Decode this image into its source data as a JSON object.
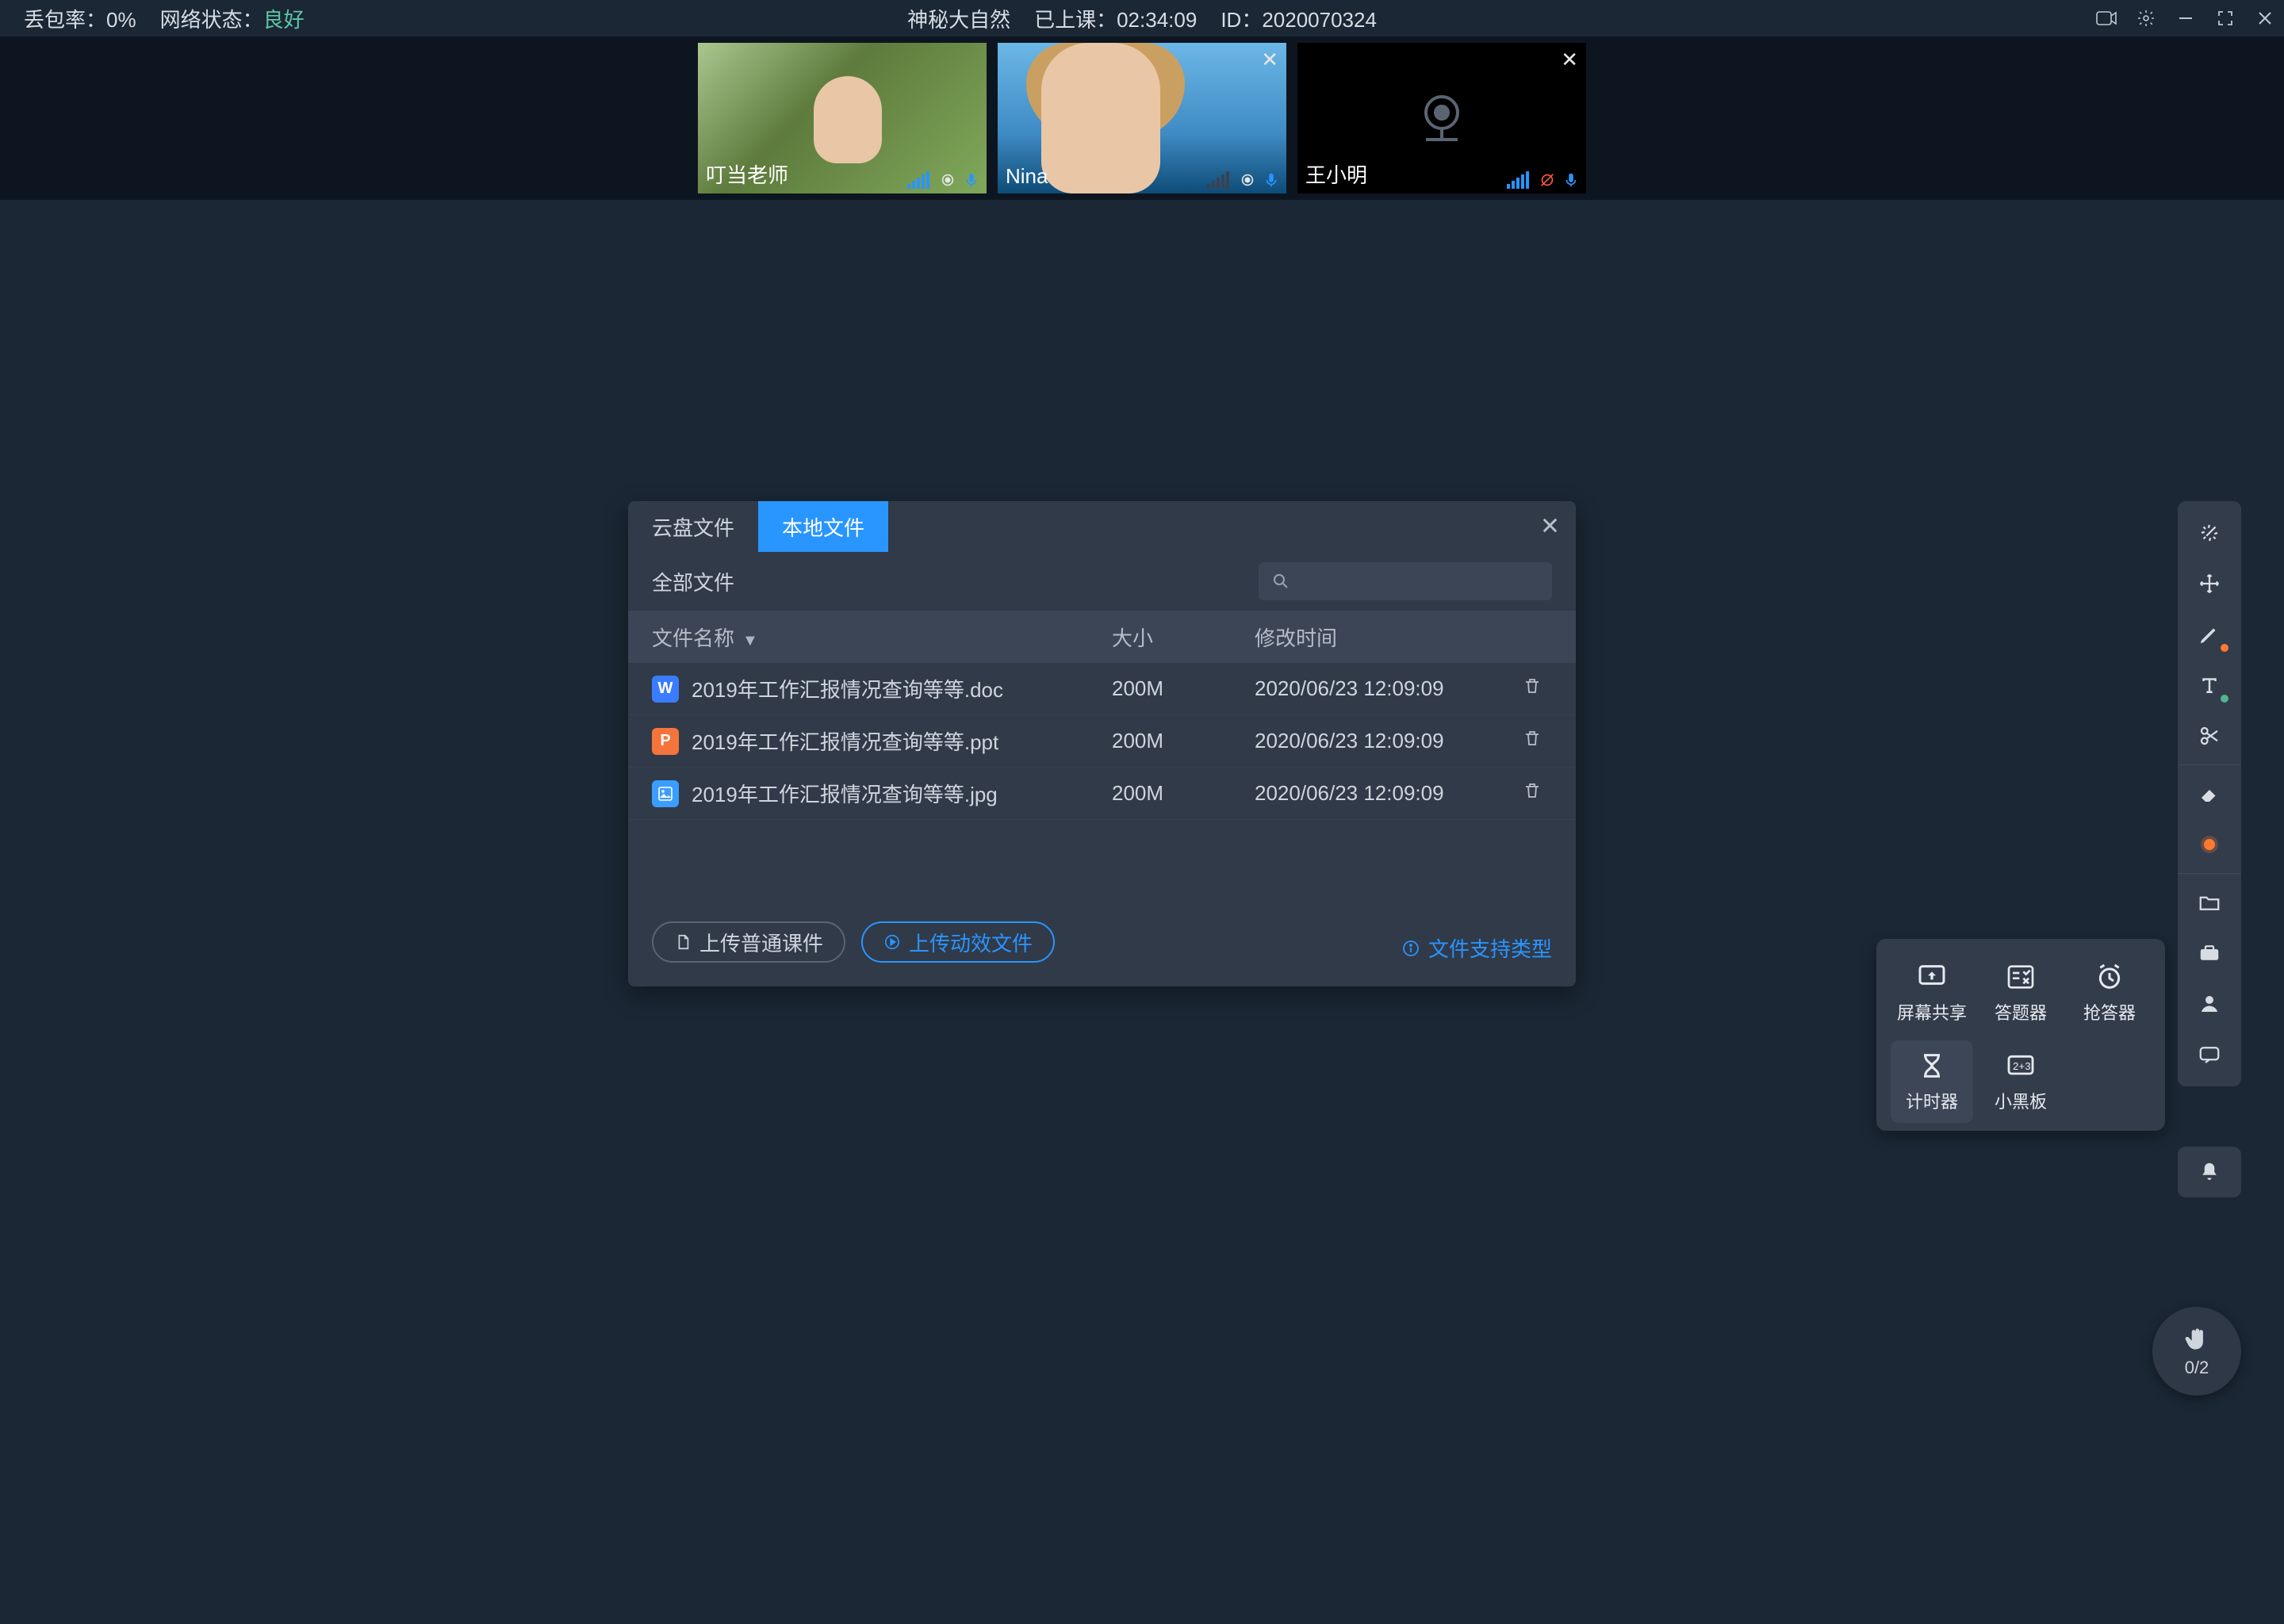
{
  "topbar": {
    "packet_loss_label": "丢包率：",
    "packet_loss_value": "0%",
    "network_label": "网络状态：",
    "network_value": "良好",
    "title": "神秘大自然",
    "elapsed_label": "已上课：",
    "elapsed_value": "02:34:09",
    "id_label": "ID：",
    "id_value": "2020070324"
  },
  "participants": [
    {
      "name": "叮当老师",
      "camera_off": false,
      "muted": false,
      "closable": false
    },
    {
      "name": "Nina",
      "camera_off": false,
      "muted": false,
      "closable": true
    },
    {
      "name": "王小明",
      "camera_off": true,
      "muted": true,
      "closable": true
    }
  ],
  "dialog": {
    "tabs": {
      "cloud": "云盘文件",
      "local": "本地文件",
      "active": "local"
    },
    "all_files": "全部文件",
    "search_placeholder": "",
    "columns": {
      "name": "文件名称",
      "size": "大小",
      "mtime": "修改时间"
    },
    "rows": [
      {
        "kind": "doc",
        "chip": "W",
        "name": "2019年工作汇报情况查询等等.doc",
        "size": "200M",
        "mtime": "2020/06/23 12:09:09"
      },
      {
        "kind": "ppt",
        "chip": "P",
        "name": "2019年工作汇报情况查询等等.ppt",
        "size": "200M",
        "mtime": "2020/06/23 12:09:09"
      },
      {
        "kind": "img",
        "chip": "▲",
        "name": "2019年工作汇报情况查询等等.jpg",
        "size": "200M",
        "mtime": "2020/06/23 12:09:09"
      }
    ],
    "btn_upload_normal": "上传普通课件",
    "btn_upload_anim": "上传动效文件",
    "link_supported": "文件支持类型"
  },
  "toolbox": {
    "screen_share": "屏幕共享",
    "quiz": "答题器",
    "buzzer": "抢答器",
    "timer": "计时器",
    "blackboard": "小黑板"
  },
  "hand_raise": {
    "count": "0/2"
  }
}
